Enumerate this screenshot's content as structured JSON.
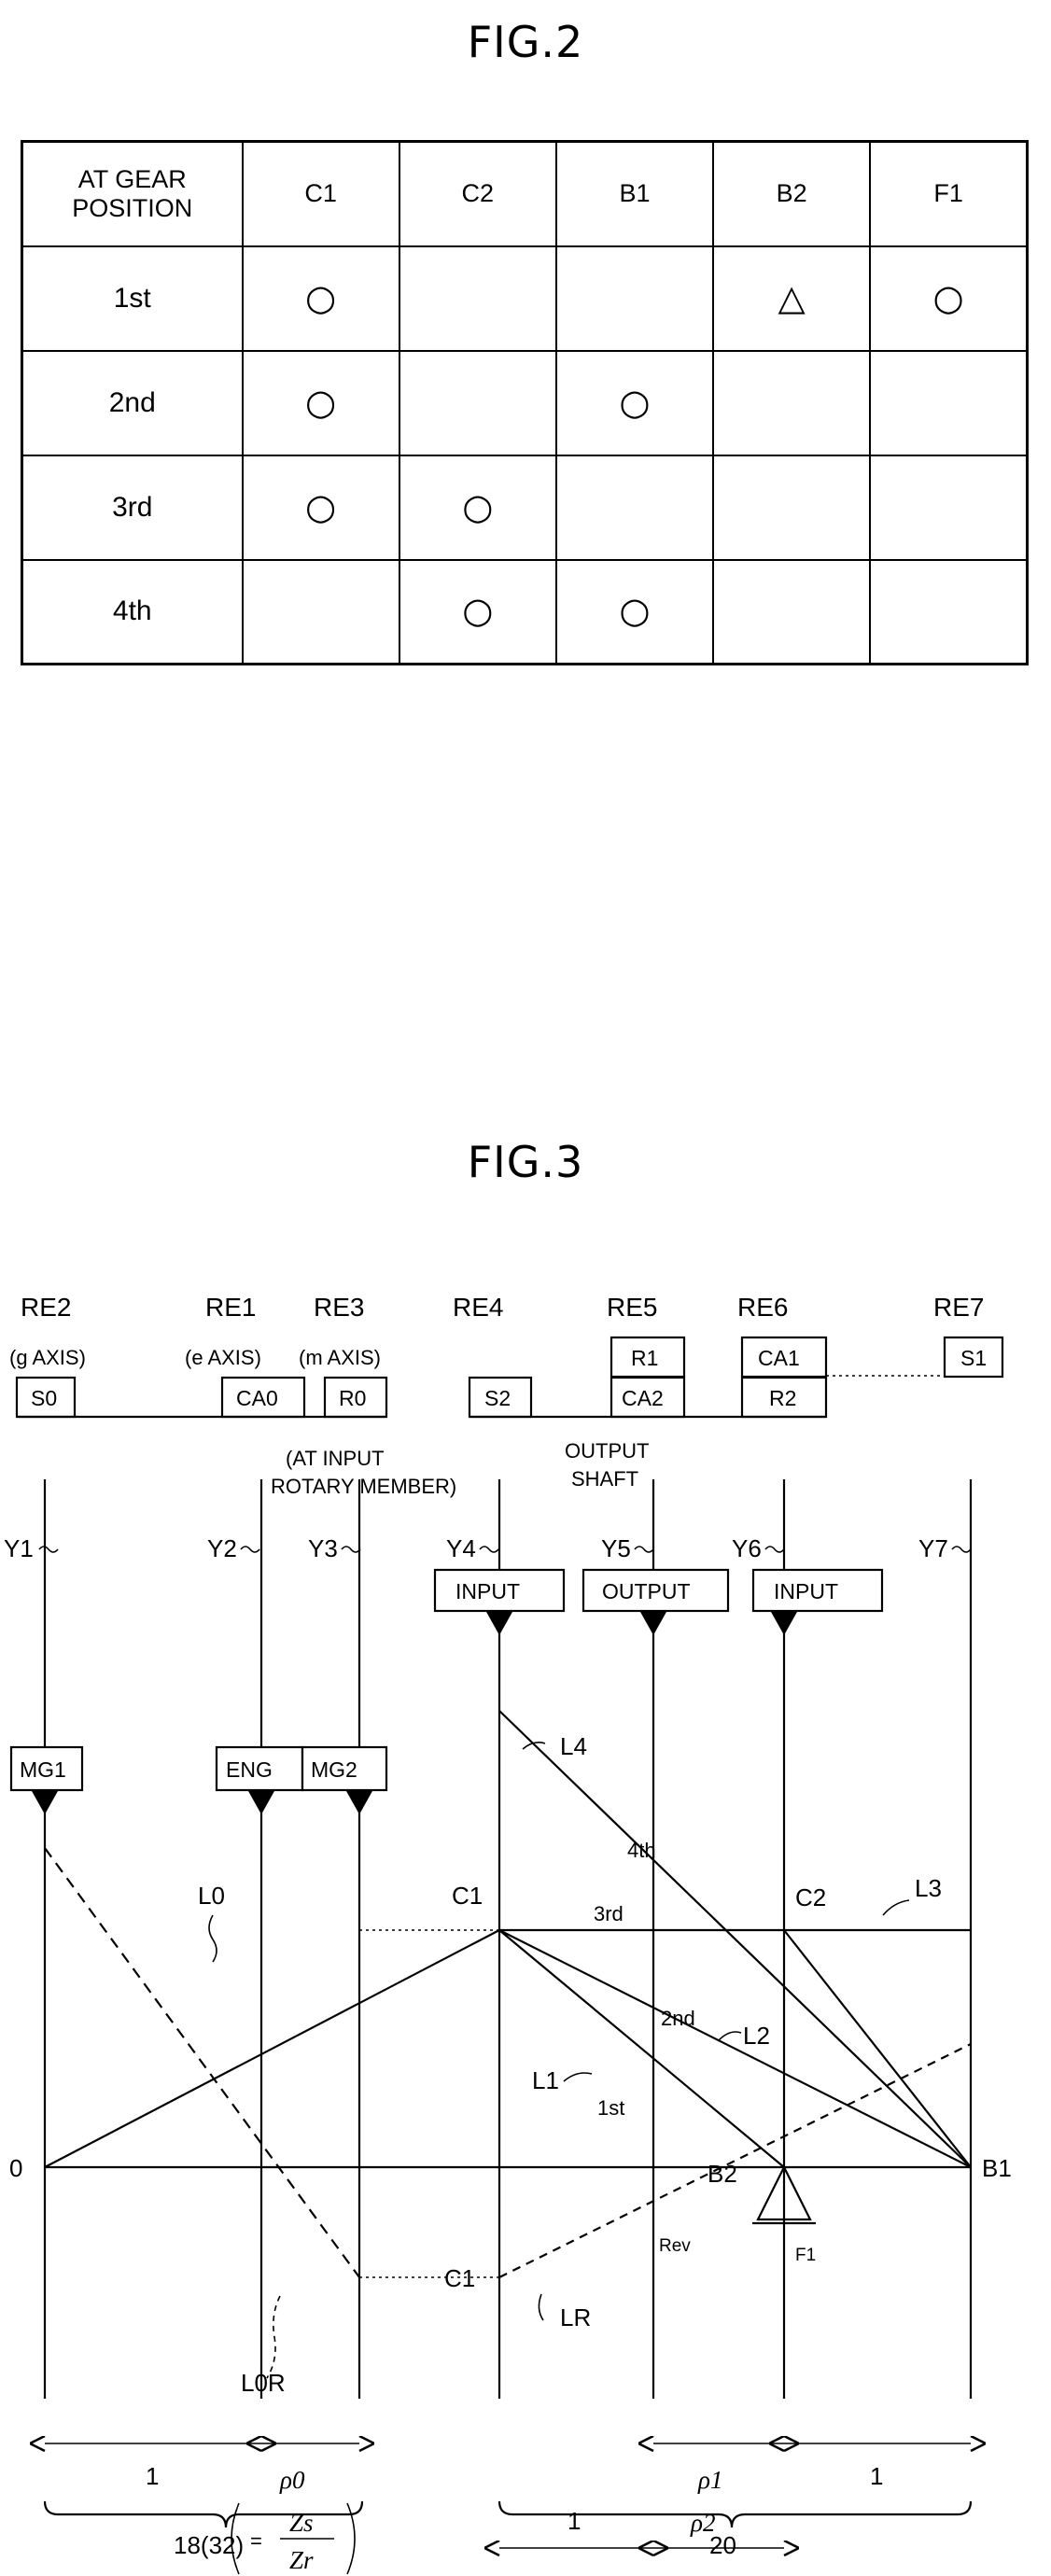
{
  "figures": {
    "fig2_title": "FIG.2",
    "fig3_title": "FIG.3"
  },
  "fig2_table": {
    "headers": [
      "AT GEAR POSITION",
      "C1",
      "C2",
      "B1",
      "B2",
      "F1"
    ],
    "header_first_line1": "AT GEAR",
    "header_first_line2": "POSITION",
    "rows": [
      {
        "gear": "1st",
        "cells": [
          "○",
          "",
          "",
          "△",
          "○"
        ]
      },
      {
        "gear": "2nd",
        "cells": [
          "○",
          "",
          "○",
          "",
          ""
        ]
      },
      {
        "gear": "3rd",
        "cells": [
          "○",
          "○",
          "",
          "",
          ""
        ]
      },
      {
        "gear": "4th",
        "cells": [
          "",
          "○",
          "○",
          "",
          ""
        ]
      }
    ],
    "symbols": {
      "engaged": "○",
      "partial": "△"
    }
  },
  "fig3": {
    "re_labels": [
      "RE2",
      "RE1",
      "RE3",
      "RE4",
      "RE5",
      "RE6",
      "RE7"
    ],
    "axis_labels": [
      "(g AXIS)",
      "(e AXIS)",
      "(m AXIS)"
    ],
    "element_boxes": [
      "S0",
      "CA0",
      "R0",
      "S2",
      "R1",
      "CA2",
      "CA1",
      "R2",
      "S1"
    ],
    "notes": {
      "at_input": "(AT INPUT",
      "at_input2": "ROTARY MEMBER)",
      "output1": "OUTPUT",
      "output2": "SHAFT"
    },
    "y_labels": [
      "Y1",
      "Y2",
      "Y3",
      "Y4",
      "Y5",
      "Y6",
      "Y7"
    ],
    "io_boxes": [
      "INPUT",
      "OUTPUT",
      "INPUT"
    ],
    "device_boxes": [
      "MG1",
      "ENG",
      "MG2"
    ],
    "line_labels": [
      "L0",
      "L1",
      "L2",
      "L3",
      "L4",
      "L0R",
      "LR"
    ],
    "gear_labels": [
      "1st",
      "2nd",
      "3rd",
      "4th",
      "Rev"
    ],
    "node_labels": [
      "C1",
      "C2",
      "B1",
      "B2",
      "F1",
      "C1"
    ],
    "zero_label": "0",
    "dimensions": {
      "top_left_1": "1",
      "rho0": "ρ0",
      "ratio_eq": "=",
      "ratio_num": "Zs",
      "ratio_den": "Zr",
      "bottom_1": "1",
      "rho2": "ρ2",
      "rho1": "ρ1",
      "right_1": "1"
    },
    "brace_labels": [
      "18(32)",
      "20"
    ]
  }
}
